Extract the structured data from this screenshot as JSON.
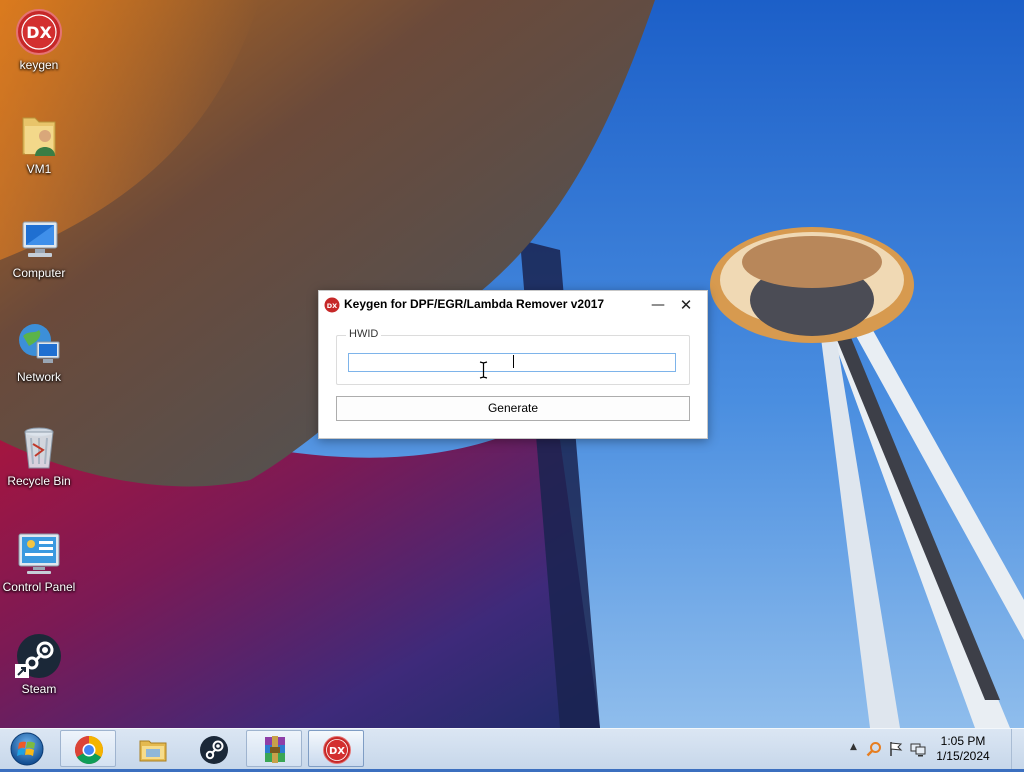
{
  "desktop": {
    "icons": [
      {
        "label": "keygen",
        "icon": "dx-app-icon"
      },
      {
        "label": "VM1",
        "icon": "user-folder-icon"
      },
      {
        "label": "Computer",
        "icon": "computer-icon"
      },
      {
        "label": "Network",
        "icon": "network-icon"
      },
      {
        "label": "Recycle Bin",
        "icon": "recycle-bin-icon"
      },
      {
        "label": "Control Panel",
        "icon": "control-panel-icon"
      },
      {
        "label": "Steam",
        "icon": "steam-icon"
      }
    ]
  },
  "dialog": {
    "title": "Keygen for DPF/EGR/Lambda Remover v2017",
    "minimize_symbol": "—",
    "close_symbol": "✕",
    "group_label": "HWID",
    "hwid_value": "",
    "generate_label": "Generate"
  },
  "taskbar": {
    "pinned": [
      {
        "name": "chrome",
        "icon": "chrome-icon"
      },
      {
        "name": "file-explorer",
        "icon": "folder-icon"
      },
      {
        "name": "steam",
        "icon": "steam-icon"
      },
      {
        "name": "winrar",
        "icon": "winrar-icon"
      },
      {
        "name": "keygen",
        "icon": "dx-app-icon"
      }
    ],
    "tray": {
      "show_hidden_symbol": "▲",
      "time": "1:05 PM",
      "date": "1/15/2024"
    }
  },
  "colors": {
    "dx_red": "#d32f2f",
    "sky_blue": "#3d7fd2",
    "taskbar_bg": "#d3e0ef",
    "input_border": "#7eb4ea"
  }
}
